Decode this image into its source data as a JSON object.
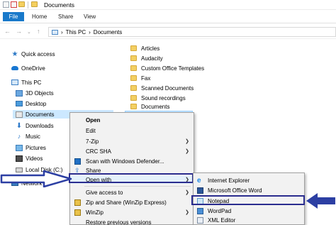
{
  "window": {
    "title": "Documents"
  },
  "ribbon": {
    "tabs": [
      "File",
      "Home",
      "Share",
      "View"
    ]
  },
  "address": {
    "path": [
      "This PC",
      "Documents"
    ],
    "separator": "›"
  },
  "nav": {
    "items": [
      {
        "label": "Quick access",
        "icon": "star-icon"
      },
      {
        "label": "OneDrive",
        "icon": "cloud-icon"
      },
      {
        "label": "This PC",
        "icon": "pc-icon"
      },
      {
        "label": "3D Objects",
        "icon": "cube-icon"
      },
      {
        "label": "Desktop",
        "icon": "desktop-icon"
      },
      {
        "label": "Documents",
        "icon": "documents-icon",
        "selected": true
      },
      {
        "label": "Downloads",
        "icon": "download-icon"
      },
      {
        "label": "Music",
        "icon": "music-icon"
      },
      {
        "label": "Pictures",
        "icon": "pictures-icon"
      },
      {
        "label": "Videos",
        "icon": "videos-icon"
      },
      {
        "label": "Local Disk (C:)",
        "icon": "disk-icon"
      },
      {
        "label": "Network",
        "icon": "network-icon"
      }
    ]
  },
  "folders": [
    "Articles",
    "Audacity",
    "Custom Office Templates",
    "Fax",
    "Scanned Documents",
    "Sound recordings",
    "Documents"
  ],
  "context_menu": {
    "items": [
      "Open",
      "Edit",
      "7-Zip",
      "CRC SHA",
      "Scan with Windows Defender...",
      "Share",
      "Open with",
      "Give access to",
      "Zip and Share (WinZip Express)",
      "WinZip",
      "Restore previous versions"
    ]
  },
  "open_with_submenu": {
    "items": [
      "Internet Explorer",
      "Microsoft Office Word",
      "Notepad",
      "WordPad",
      "XML Editor"
    ]
  },
  "colors": {
    "file_tab": "#1979ca",
    "highlight_border": "#2b2d8f",
    "arrow": "#2c3fa3",
    "selection": "#cce8ff"
  }
}
